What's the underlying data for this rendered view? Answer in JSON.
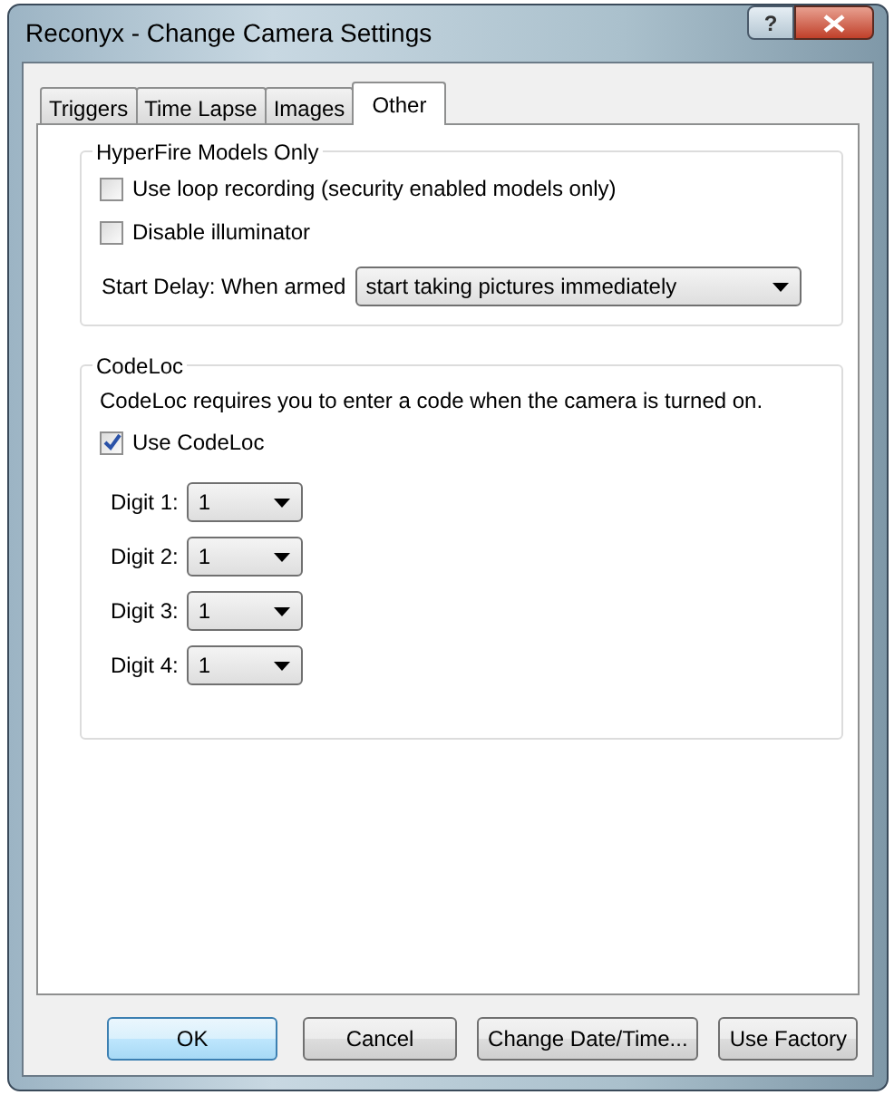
{
  "window": {
    "title": "Reconyx - Change Camera Settings",
    "help_button": "?"
  },
  "tabs": [
    {
      "label": "Triggers",
      "selected": false
    },
    {
      "label": "Time Lapse",
      "selected": false
    },
    {
      "label": "Images",
      "selected": false
    },
    {
      "label": "Other",
      "selected": true
    }
  ],
  "hyperfire": {
    "title": "HyperFire Models Only",
    "checkboxes": [
      {
        "label": "Use loop recording (security enabled models only)",
        "checked": false
      },
      {
        "label": "Disable illuminator",
        "checked": false
      }
    ],
    "start_delay": {
      "label": "Start Delay: When armed",
      "value": "start taking pictures immediately"
    }
  },
  "codeloc": {
    "title": "CodeLoc",
    "description": "CodeLoc requires you to enter a code when the camera is turned on.",
    "use_codeloc": {
      "label": "Use CodeLoc",
      "checked": true
    },
    "digits": [
      {
        "label": "Digit 1:",
        "value": "1"
      },
      {
        "label": "Digit 2:",
        "value": "1"
      },
      {
        "label": "Digit 3:",
        "value": "1"
      },
      {
        "label": "Digit 4:",
        "value": "1"
      }
    ]
  },
  "buttons": [
    {
      "label": "OK",
      "default": true
    },
    {
      "label": "Cancel",
      "default": false
    },
    {
      "label": "Change Date/Time...",
      "default": false
    },
    {
      "label": "Use Factory",
      "default": false
    }
  ]
}
